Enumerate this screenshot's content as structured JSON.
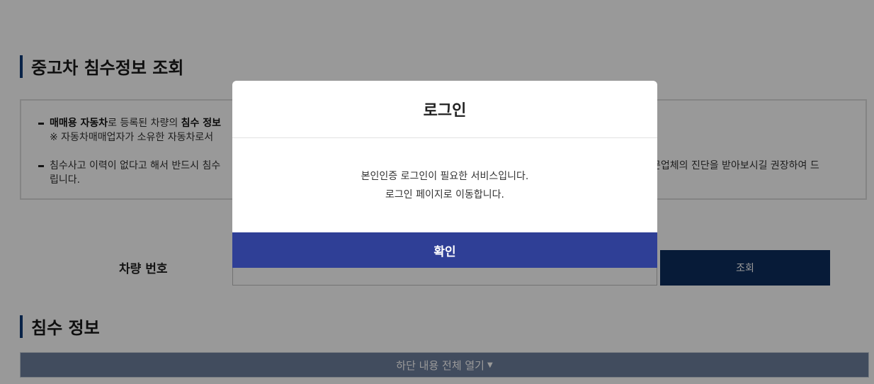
{
  "page": {
    "title": "중고차 침수정보 조회",
    "notices": [
      {
        "bold1": "매매용 자동차",
        "text1": "로 등록된 차량의 ",
        "bold2": "침수 정보",
        "line2": "※ 자동차매매업자가 소유한 자동차로서"
      },
      {
        "line1": "침수사고 이력이 없다고 해서 반드시 침수",
        "line1_right": "문업체의 진단을 받아보시길 권장하여 드",
        "line2": "립니다."
      }
    ],
    "car_number_label": "차량 번호",
    "car_number_value": "",
    "search_button": "조회",
    "flood_info_title": "침수 정보",
    "expand_all": "하단 내용 전체 열기",
    "expand_caret": "▼"
  },
  "modal": {
    "title": "로그인",
    "message_line1": "본인인증 로그인이 필요한 서비스입니다.",
    "message_line2": "로그인 페이지로 이동합니다.",
    "confirm_button": "확인"
  },
  "colors": {
    "title_accent": "#0f3b78",
    "search_button": "#0d2d5e",
    "expand_bar": "#6d7f9d",
    "modal_confirm": "#2f3f96"
  }
}
